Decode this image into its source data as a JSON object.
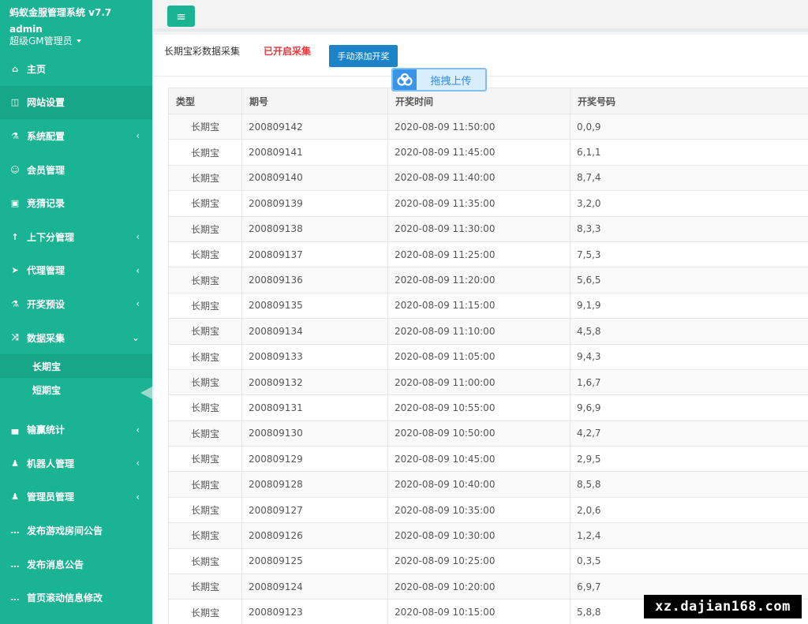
{
  "sidebar": {
    "brand_title": "蚂蚁金服管理系统 v7.7",
    "user_name": "admin",
    "user_role": "超级GM管理员",
    "items": [
      {
        "label": "主页",
        "icon": "home-icon",
        "glyph": "⌂",
        "arrow": ""
      },
      {
        "label": "网站设置",
        "icon": "columns-icon",
        "glyph": "◫",
        "arrow": ""
      },
      {
        "label": "系统配置",
        "icon": "flask-icon",
        "glyph": "⚗",
        "arrow": "‹"
      },
      {
        "label": "会员管理",
        "icon": "user-icon",
        "glyph": "☺",
        "arrow": ""
      },
      {
        "label": "竞猜记录",
        "icon": "car-icon",
        "glyph": "▣",
        "arrow": ""
      },
      {
        "label": "上下分管理",
        "icon": "level-up-icon",
        "glyph": "↑",
        "arrow": "‹"
      },
      {
        "label": "代理管理",
        "icon": "paper-plane-icon",
        "glyph": "➤",
        "arrow": "‹"
      },
      {
        "label": "开奖预设",
        "icon": "flask-icon",
        "glyph": "⚗",
        "arrow": "‹"
      },
      {
        "label": "数据采集",
        "icon": "random-icon",
        "glyph": "⤨",
        "arrow": "⌄"
      }
    ],
    "sub_items": [
      "长期宝",
      "短期宝"
    ],
    "items_after": [
      {
        "label": "输赢统计",
        "icon": "bar-chart-icon",
        "glyph": "▄",
        "arrow": "‹"
      },
      {
        "label": "机器人管理",
        "icon": "male-icon",
        "glyph": "♟",
        "arrow": "‹"
      },
      {
        "label": "管理员管理",
        "icon": "male-icon",
        "glyph": "♟",
        "arrow": "‹"
      },
      {
        "label": "发布游戏房间公告",
        "icon": "comment-icon",
        "glyph": "…",
        "arrow": ""
      },
      {
        "label": "发布消息公告",
        "icon": "comment-icon",
        "glyph": "…",
        "arrow": ""
      },
      {
        "label": "首页滚动信息修改",
        "icon": "comment-icon",
        "glyph": "…",
        "arrow": ""
      }
    ]
  },
  "toolbar": {
    "menu_glyph": "≡"
  },
  "panel": {
    "title": "长期宝彩数据采集",
    "status": "已开启采集",
    "add_button": "手动添加开奖",
    "upload_label": "拖拽上传"
  },
  "table": {
    "headers": [
      "类型",
      "期号",
      "开奖时间",
      "开奖号码"
    ],
    "rows": [
      [
        "长期宝",
        "200809142",
        "2020-08-09 11:50:00",
        "0,0,9"
      ],
      [
        "长期宝",
        "200809141",
        "2020-08-09 11:45:00",
        "6,1,1"
      ],
      [
        "长期宝",
        "200809140",
        "2020-08-09 11:40:00",
        "8,7,4"
      ],
      [
        "长期宝",
        "200809139",
        "2020-08-09 11:35:00",
        "3,2,0"
      ],
      [
        "长期宝",
        "200809138",
        "2020-08-09 11:30:00",
        "8,3,3"
      ],
      [
        "长期宝",
        "200809137",
        "2020-08-09 11:25:00",
        "7,5,3"
      ],
      [
        "长期宝",
        "200809136",
        "2020-08-09 11:20:00",
        "5,6,5"
      ],
      [
        "长期宝",
        "200809135",
        "2020-08-09 11:15:00",
        "9,1,9"
      ],
      [
        "长期宝",
        "200809134",
        "2020-08-09 11:10:00",
        "4,5,8"
      ],
      [
        "长期宝",
        "200809133",
        "2020-08-09 11:05:00",
        "9,4,3"
      ],
      [
        "长期宝",
        "200809132",
        "2020-08-09 11:00:00",
        "1,6,7"
      ],
      [
        "长期宝",
        "200809131",
        "2020-08-09 10:55:00",
        "9,6,9"
      ],
      [
        "长期宝",
        "200809130",
        "2020-08-09 10:50:00",
        "4,2,7"
      ],
      [
        "长期宝",
        "200809129",
        "2020-08-09 10:45:00",
        "2,9,5"
      ],
      [
        "长期宝",
        "200809128",
        "2020-08-09 10:40:00",
        "8,5,8"
      ],
      [
        "长期宝",
        "200809127",
        "2020-08-09 10:35:00",
        "2,0,6"
      ],
      [
        "长期宝",
        "200809126",
        "2020-08-09 10:30:00",
        "1,2,4"
      ],
      [
        "长期宝",
        "200809125",
        "2020-08-09 10:25:00",
        "0,3,5"
      ],
      [
        "长期宝",
        "200809124",
        "2020-08-09 10:20:00",
        "6,9,7"
      ],
      [
        "长期宝",
        "200809123",
        "2020-08-09 10:15:00",
        "5,8,8"
      ]
    ]
  },
  "watermark": "xz.dajian168.com",
  "colors": {
    "sidebar": "#1ab394",
    "button": "#1c84c6",
    "status": "#e4393c"
  }
}
